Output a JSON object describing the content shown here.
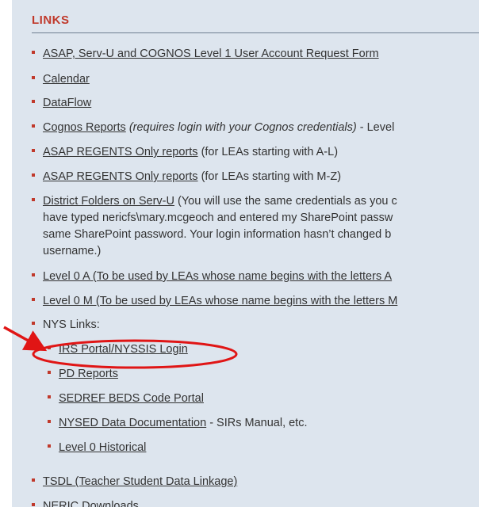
{
  "heading": "LINKS",
  "items": {
    "account_form": {
      "link": "ASAP, Serv-U and COGNOS Level 1 User Account Request Form"
    },
    "calendar": {
      "link": "Calendar"
    },
    "dataflow": {
      "link": "DataFlow"
    },
    "cognos": {
      "link": "Cognos Reports",
      "note": "(requires login with your Cognos credentials)",
      "rest": " - Level"
    },
    "regents_al": {
      "link": "ASAP REGENTS Only reports",
      "rest": " (for LEAs starting with A-L)"
    },
    "regents_mz": {
      "link": "ASAP REGENTS Only reports",
      "rest": " (for LEAs starting with M-Z)"
    },
    "district_folders": {
      "link": "District Folders on Serv-U",
      "line1_rest": " (You will use the same credentials as you c",
      "line2": "have typed nericfs\\mary.mcgeoch and entered my SharePoint passw",
      "line3": "same SharePoint password. Your login information hasn’t changed b",
      "line4": "username.)"
    },
    "level0_a": {
      "link": "Level 0 A (To be used by LEAs whose name begins with the letters A"
    },
    "level0_m": {
      "link": "Level 0 M (To be used by LEAs whose name begins with the letters M"
    },
    "nys_links": {
      "label": "NYS Links:"
    },
    "nys_sub": {
      "irs_portal": "IRS Portal/NYSSIS Login",
      "pd_reports": "PD Reports",
      "sedref": "SEDREF BEDS Code Portal",
      "nysed_docs": {
        "link": "NYSED Data Documentation",
        "rest": " - SIRs Manual, etc."
      },
      "level0_hist": "Level 0 Historical"
    },
    "tsdl": {
      "link": "TSDL (Teacher Student Data Linkage)"
    },
    "neric": {
      "link": "NERIC Downloads"
    }
  },
  "colors": {
    "panel_bg": "#dde5ee",
    "accent_red": "#c0392b",
    "annotation_red": "#e01515",
    "text": "#333333"
  }
}
